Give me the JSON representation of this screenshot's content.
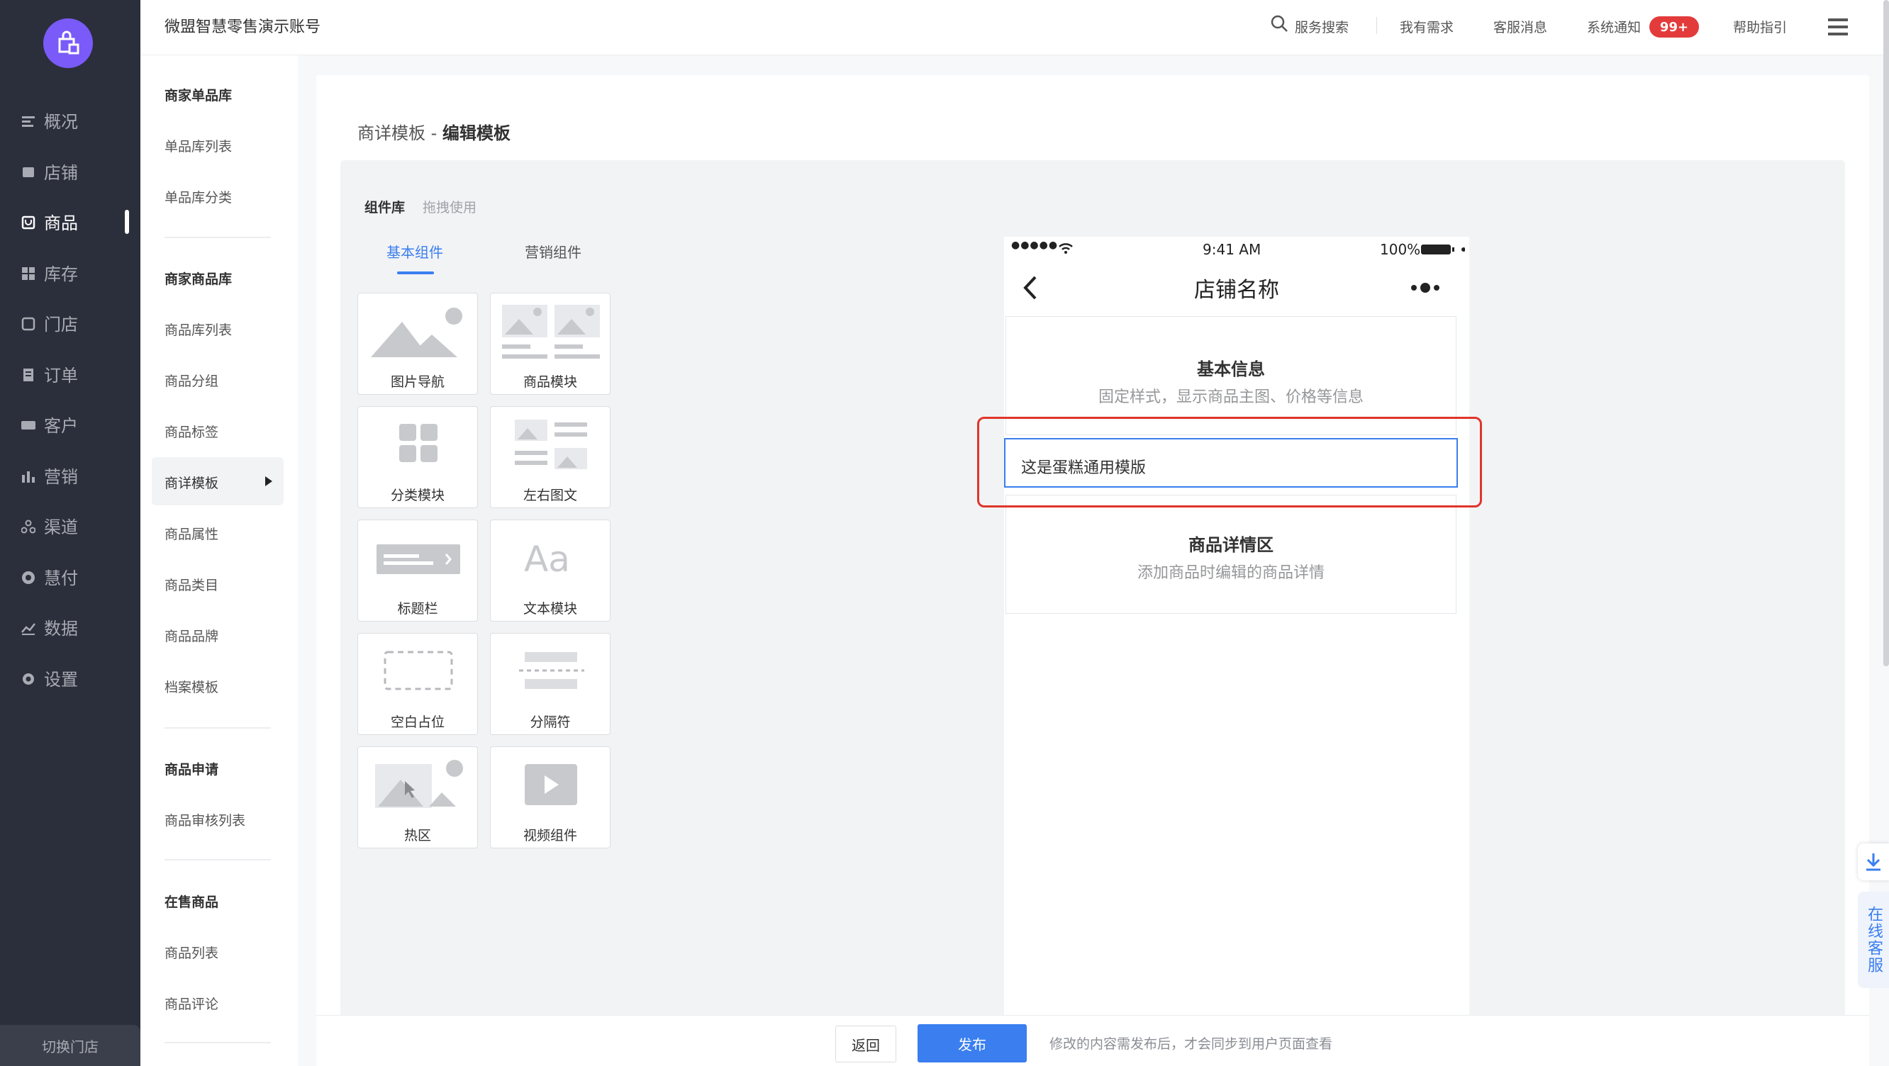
{
  "topbar": {
    "account": "微盟智慧零售演示账号",
    "search": "服务搜索",
    "needs": "我有需求",
    "service_msg": "客服消息",
    "notice": "系统通知",
    "notice_badge": "99+",
    "help": "帮助指引"
  },
  "nav": {
    "items": [
      {
        "label": "概况",
        "icon": "overview-icon"
      },
      {
        "label": "店铺",
        "icon": "store-icon"
      },
      {
        "label": "商品",
        "icon": "goods-icon",
        "active": true
      },
      {
        "label": "库存",
        "icon": "stock-icon"
      },
      {
        "label": "门店",
        "icon": "shop-icon"
      },
      {
        "label": "订单",
        "icon": "order-icon"
      },
      {
        "label": "客户",
        "icon": "customer-icon"
      },
      {
        "label": "营销",
        "icon": "marketing-icon"
      },
      {
        "label": "渠道",
        "icon": "channel-icon"
      },
      {
        "label": "慧付",
        "icon": "pay-icon"
      },
      {
        "label": "数据",
        "icon": "data-icon"
      },
      {
        "label": "设置",
        "icon": "settings-icon"
      }
    ],
    "switch_store": "切换门店"
  },
  "subnav": {
    "g1_title": "商家单品库",
    "g1_i1": "单品库列表",
    "g1_i2": "单品库分类",
    "g2_title": "商家商品库",
    "g2_i1": "商品库列表",
    "g2_i2": "商品分组",
    "g2_i3": "商品标签",
    "g2_i4": "商详模板",
    "g2_i5": "商品属性",
    "g2_i6": "商品类目",
    "g2_i7": "商品品牌",
    "g2_i8": "档案模板",
    "g3_title": "商品申请",
    "g3_i1": "商品审核列表",
    "g4_title": "在售商品",
    "g4_i1": "商品列表",
    "g4_i2": "商品评论"
  },
  "page": {
    "crumb_parent": "商详模板",
    "crumb_sep": " - ",
    "crumb_current": "编辑模板"
  },
  "library": {
    "title": "组件库",
    "hint": "拖拽使用",
    "tab_basic": "基本组件",
    "tab_marketing": "营销组件",
    "tiles": [
      "图片导航",
      "商品模块",
      "分类模块",
      "左右图文",
      "标题栏",
      "文本模块",
      "空白占位",
      "分隔符",
      "热区",
      "视频组件"
    ]
  },
  "phone": {
    "signal": "●●●●●",
    "time": "9:41 AM",
    "battery": "100%",
    "title": "店铺名称",
    "basic_title": "基本信息",
    "basic_desc": "固定样式，显示商品主图、价格等信息",
    "template_text": "这是蛋糕通用模版",
    "detail_title": "商品详情区",
    "detail_desc": "添加商品时编辑的商品详情"
  },
  "footer": {
    "back": "返回",
    "publish": "发布",
    "hint": "修改的内容需发布后，才会同步到用户页面查看"
  },
  "float": {
    "customer_service": "在线客服"
  },
  "colors": {
    "nav_bg": "#2b2f3b",
    "accent": "#3a7ef0",
    "badge": "#e33b3b",
    "highlight": "#e0352b",
    "logo": "#7a5af8"
  }
}
